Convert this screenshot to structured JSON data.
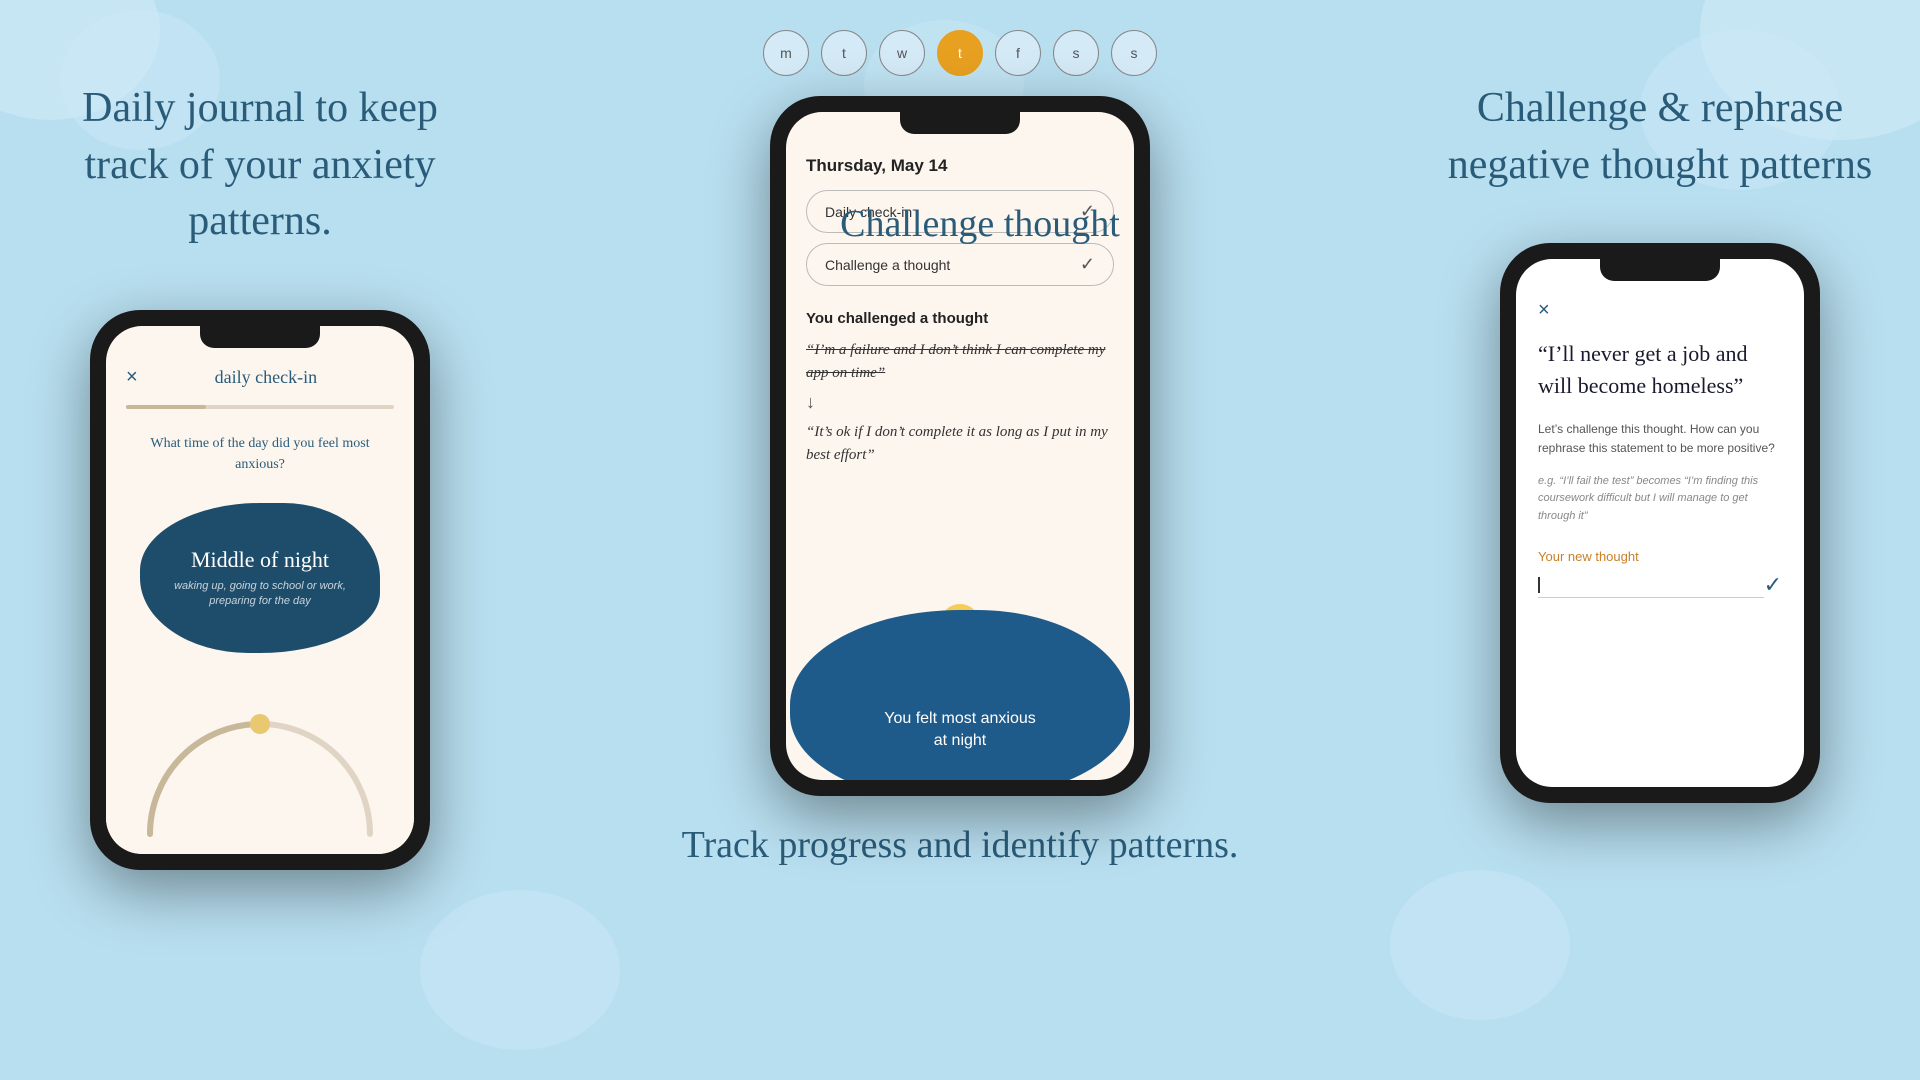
{
  "background": {
    "color": "#b8dff0"
  },
  "left": {
    "title": "Daily journal to keep track of your anxiety patterns.",
    "phone": {
      "header": {
        "close": "×",
        "title": "daily check-in"
      },
      "question": "What time of the day did you feel most anxious?",
      "blob": {
        "title": "Middle of night",
        "subtitle": "waking up, going to school or work, preparing for the day"
      }
    }
  },
  "center": {
    "days": [
      {
        "label": "m",
        "active": false
      },
      {
        "label": "t",
        "active": false
      },
      {
        "label": "w",
        "active": false
      },
      {
        "label": "t",
        "active": true
      },
      {
        "label": "f",
        "active": false
      },
      {
        "label": "s",
        "active": false
      },
      {
        "label": "s",
        "active": false
      }
    ],
    "date": "Thursday, May 14",
    "tasks": [
      {
        "label": "Daily check-in",
        "done": true
      },
      {
        "label": "Challenge a thought",
        "done": true
      }
    ],
    "challenged": {
      "title": "You challenged a thought",
      "original": "“I’m a failure and I don’t think I can complete my app on time”",
      "arrow": "↓",
      "new_thought": "“It’s ok if I don’t complete it as long as I put in my best effort”"
    },
    "blob": {
      "text_line1": "You felt most anxious",
      "text_line2": "at night"
    },
    "bottom_text": "Track progress and identify patterns."
  },
  "top_center": {
    "title": "Challenge thought"
  },
  "right": {
    "title": "Challenge & rephrase negative thought patterns",
    "phone": {
      "close": "×",
      "quote": "“I’ll never get a job and will become homeless”",
      "instruction": "Let’s challenge this thought. How can you rephrase this statement to be more positive?",
      "example": "e.g. “I’ll fail the test” becomes “I’m finding this coursework difficult but I will manage to get through it”",
      "input_label": "Your new thought",
      "input_placeholder": ""
    }
  }
}
